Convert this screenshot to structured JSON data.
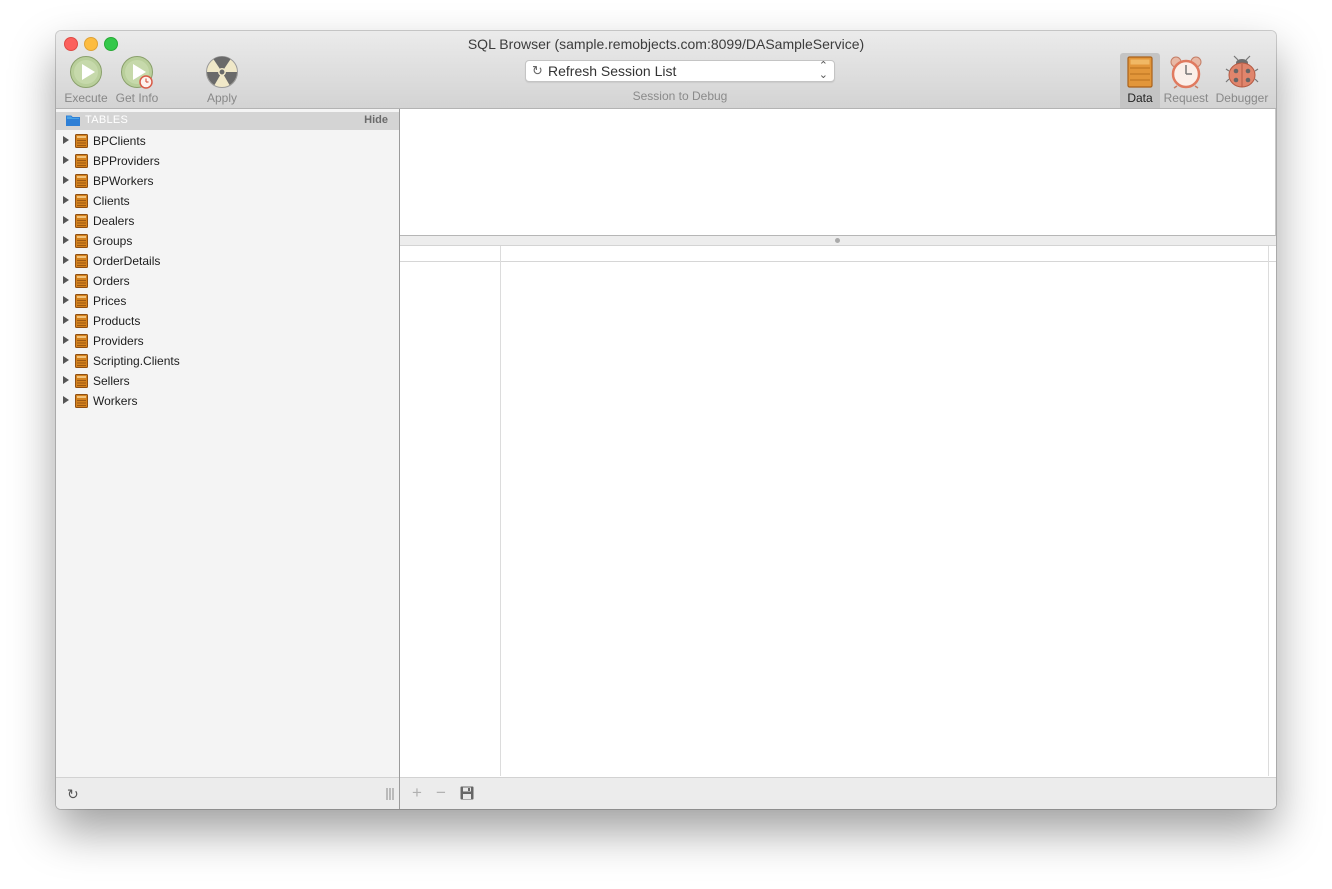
{
  "window": {
    "title": "SQL Browser (sample.remobjects.com:8099/DASampleService)"
  },
  "toolbar": {
    "execute_label": "Execute",
    "get_info_label": "Get Info",
    "apply_label": "Apply",
    "session_select_value": "Refresh Session List",
    "session_label": "Session to Debug",
    "modes": [
      {
        "label": "Data",
        "selected": true
      },
      {
        "label": "Request",
        "selected": false
      },
      {
        "label": "Debugger",
        "selected": false
      }
    ]
  },
  "sidebar": {
    "header_title": "TABLES",
    "hide_label": "Hide",
    "tables": [
      {
        "label": "BPClients"
      },
      {
        "label": "BPProviders"
      },
      {
        "label": "BPWorkers"
      },
      {
        "label": "Clients"
      },
      {
        "label": "Dealers"
      },
      {
        "label": "Groups"
      },
      {
        "label": "OrderDetails"
      },
      {
        "label": "Orders"
      },
      {
        "label": "Prices"
      },
      {
        "label": "Products"
      },
      {
        "label": "Providers"
      },
      {
        "label": "Scripting.Clients"
      },
      {
        "label": "Sellers"
      },
      {
        "label": "Workers"
      }
    ]
  },
  "footer": {
    "add_glyph": "+",
    "remove_glyph": "−",
    "refresh_glyph": "↻"
  },
  "icons": {
    "execute": "play-icon",
    "get_info": "play-clock-icon",
    "apply": "radiation-icon",
    "data": "crate-icon",
    "request": "alarm-clock-icon",
    "debugger": "ladybug-icon",
    "table": "table-icon",
    "folder": "folder-icon",
    "save": "floppy-disk-icon"
  },
  "colors": {
    "accent_blue": "#2e7fd6",
    "table_icon": "#d4821e",
    "close": "#fc605c",
    "minimize": "#fdbc40",
    "maximize": "#34c84a"
  }
}
